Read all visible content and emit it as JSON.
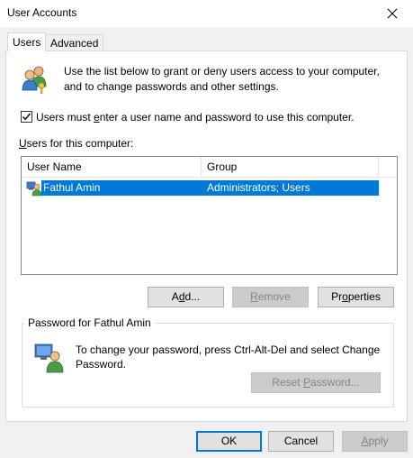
{
  "window": {
    "title": "User Accounts"
  },
  "tabs": [
    {
      "label": "Users",
      "active": true
    },
    {
      "label": "Advanced",
      "active": false
    }
  ],
  "intro": {
    "line1": "Use the list below to grant or deny users access to your computer,",
    "line2": "and to change passwords and other settings."
  },
  "require_login": {
    "label_pre": "Users must ",
    "label_key": "e",
    "label_post": "nter a user name and password to use this computer.",
    "checked": true
  },
  "users_list": {
    "label_key": "U",
    "label_rest": "sers for this computer:",
    "columns": [
      "User Name",
      "Group"
    ],
    "rows": [
      {
        "user": "Fathul Amin",
        "group": "Administrators; Users",
        "selected": true
      }
    ]
  },
  "list_buttons": {
    "add_pre": "A",
    "add_key": "d",
    "add_post": "d...",
    "remove_key": "R",
    "remove_rest": "emove",
    "properties_pre": "Pr",
    "properties_key": "o",
    "properties_post": "perties"
  },
  "password_group": {
    "title": "Password for Fathul Amin",
    "line1": "To change your password, press Ctrl-Alt-Del and select Change",
    "line2": "Password.",
    "reset_pre": "Reset ",
    "reset_key": "P",
    "reset_post": "assword..."
  },
  "footer": {
    "ok": "OK",
    "cancel": "Cancel",
    "apply_key": "A",
    "apply_rest": "pply"
  },
  "colors": {
    "selection": "#0078d7",
    "window_bg": "#f0f0f0",
    "panel_bg": "#ffffff"
  },
  "icons": {
    "users_header": "users-group-icon",
    "user_row": "user-icon",
    "password": "user-password-icon",
    "close": "close-icon",
    "checkmark": "checkmark-icon"
  }
}
